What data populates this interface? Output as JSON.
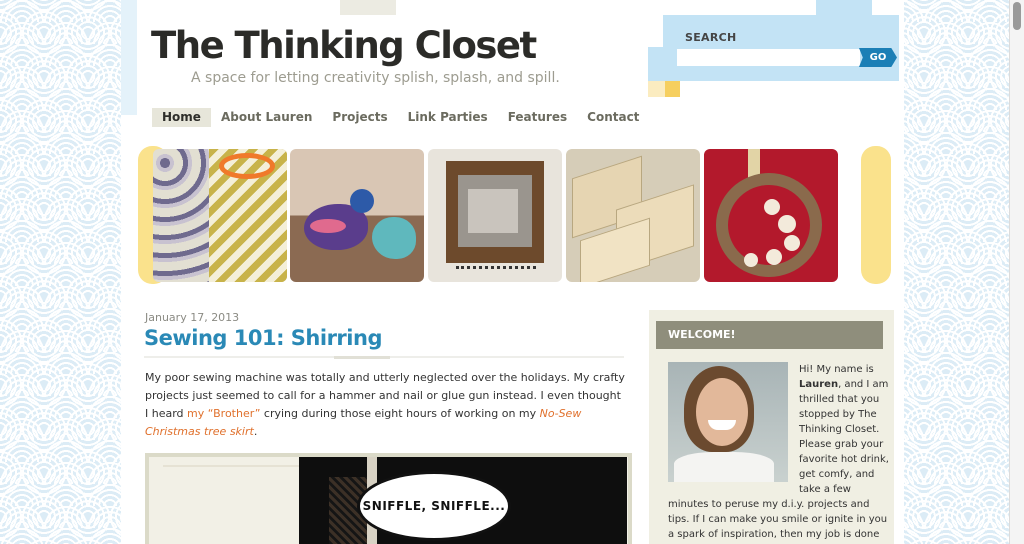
{
  "header": {
    "site_title": "The Thinking Closet",
    "tagline": "A space for letting creativity splish, splash, and spill."
  },
  "search": {
    "label": "SEARCH",
    "placeholder": "",
    "go_label": "GO"
  },
  "nav": {
    "items": [
      {
        "label": "Home",
        "active": true
      },
      {
        "label": "About Lauren",
        "active": false
      },
      {
        "label": "Projects",
        "active": false
      },
      {
        "label": "Link Parties",
        "active": false
      },
      {
        "label": "Features",
        "active": false
      },
      {
        "label": "Contact",
        "active": false
      }
    ]
  },
  "banner": {
    "photos": [
      "owl-fabric-and-scissors-photo",
      "fabric-birds-photo",
      "rustic-frame-with-hooks-photo",
      "wood-panels-photo",
      "felt-flower-wreath-photo"
    ]
  },
  "post": {
    "date": "January 17, 2013",
    "title": "Sewing 101: Shirring",
    "body_part1": "My poor sewing machine was totally and utterly neglected over the holidays.  My crafty projects just seemed to call for a hammer and nail or glue gun instead.  I even thought I heard ",
    "link1": "my “Brother”",
    "body_part2": " crying during those eight hours of working on my ",
    "link2": "No-Sew Christmas tree skirt",
    "body_part3": ".",
    "image_caption": "SNIFFLE, SNIFFLE..."
  },
  "sidebar": {
    "welcome_title": "WELCOME!",
    "intro_pre": "Hi! My name is ",
    "intro_name": "Lauren",
    "intro_post": ", and I am thrilled that you stopped by The Thinking Closet. Please grab your favorite hot drink, get comfy, and take a few",
    "intro_cont": "minutes to peruse my d.i.y. projects and tips. If I can make you smile or ignite in you a spark of inspiration, then my job is done"
  },
  "colors": {
    "accent_blue": "#2a89b6",
    "link_orange": "#e0712d",
    "search_bg": "#c3e3f5",
    "banner_scallop": "#fae28c",
    "sidebar_header": "#8f8e7c"
  }
}
